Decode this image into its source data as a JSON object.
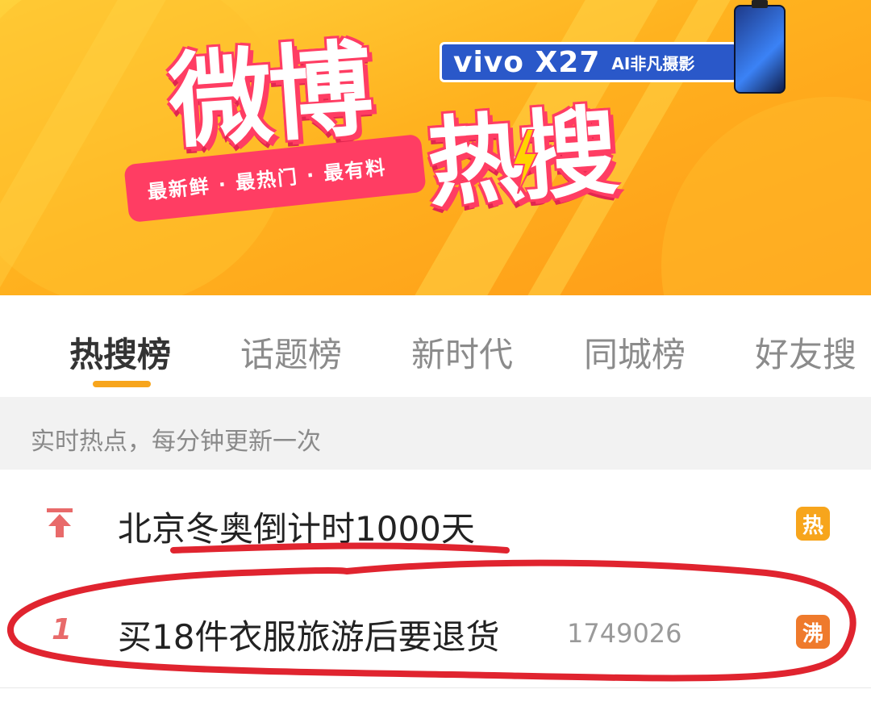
{
  "banner": {
    "title_main": "微博",
    "title_sub": "热搜",
    "slogan": "最新鲜 · 最热门 · 最有料",
    "sponsor_brand": "vivo X27",
    "sponsor_tagline": "AI非凡摄影",
    "colors": {
      "background": "#ffb21f",
      "accent": "#ff3d63",
      "sponsor_bg": "#2a58c9"
    }
  },
  "tabs": [
    {
      "label": "热搜榜",
      "active": true
    },
    {
      "label": "话题榜",
      "active": false
    },
    {
      "label": "新时代",
      "active": false
    },
    {
      "label": "同城榜",
      "active": false
    },
    {
      "label": "好友搜",
      "active": false
    }
  ],
  "info_bar": {
    "text": "实时热点，每分钟更新一次"
  },
  "list": [
    {
      "rank": "",
      "rank_icon": "arrow-up-top-icon",
      "title": "北京冬奥倒计时1000天",
      "count": "",
      "badge": "热",
      "badge_color": "#f7a51c"
    },
    {
      "rank": "1",
      "title": "买18件衣服旅游后要退货",
      "count": "1749026",
      "badge": "沸",
      "badge_color": "#ef7a2c"
    }
  ],
  "annotation": {
    "color": "#e0242f"
  }
}
